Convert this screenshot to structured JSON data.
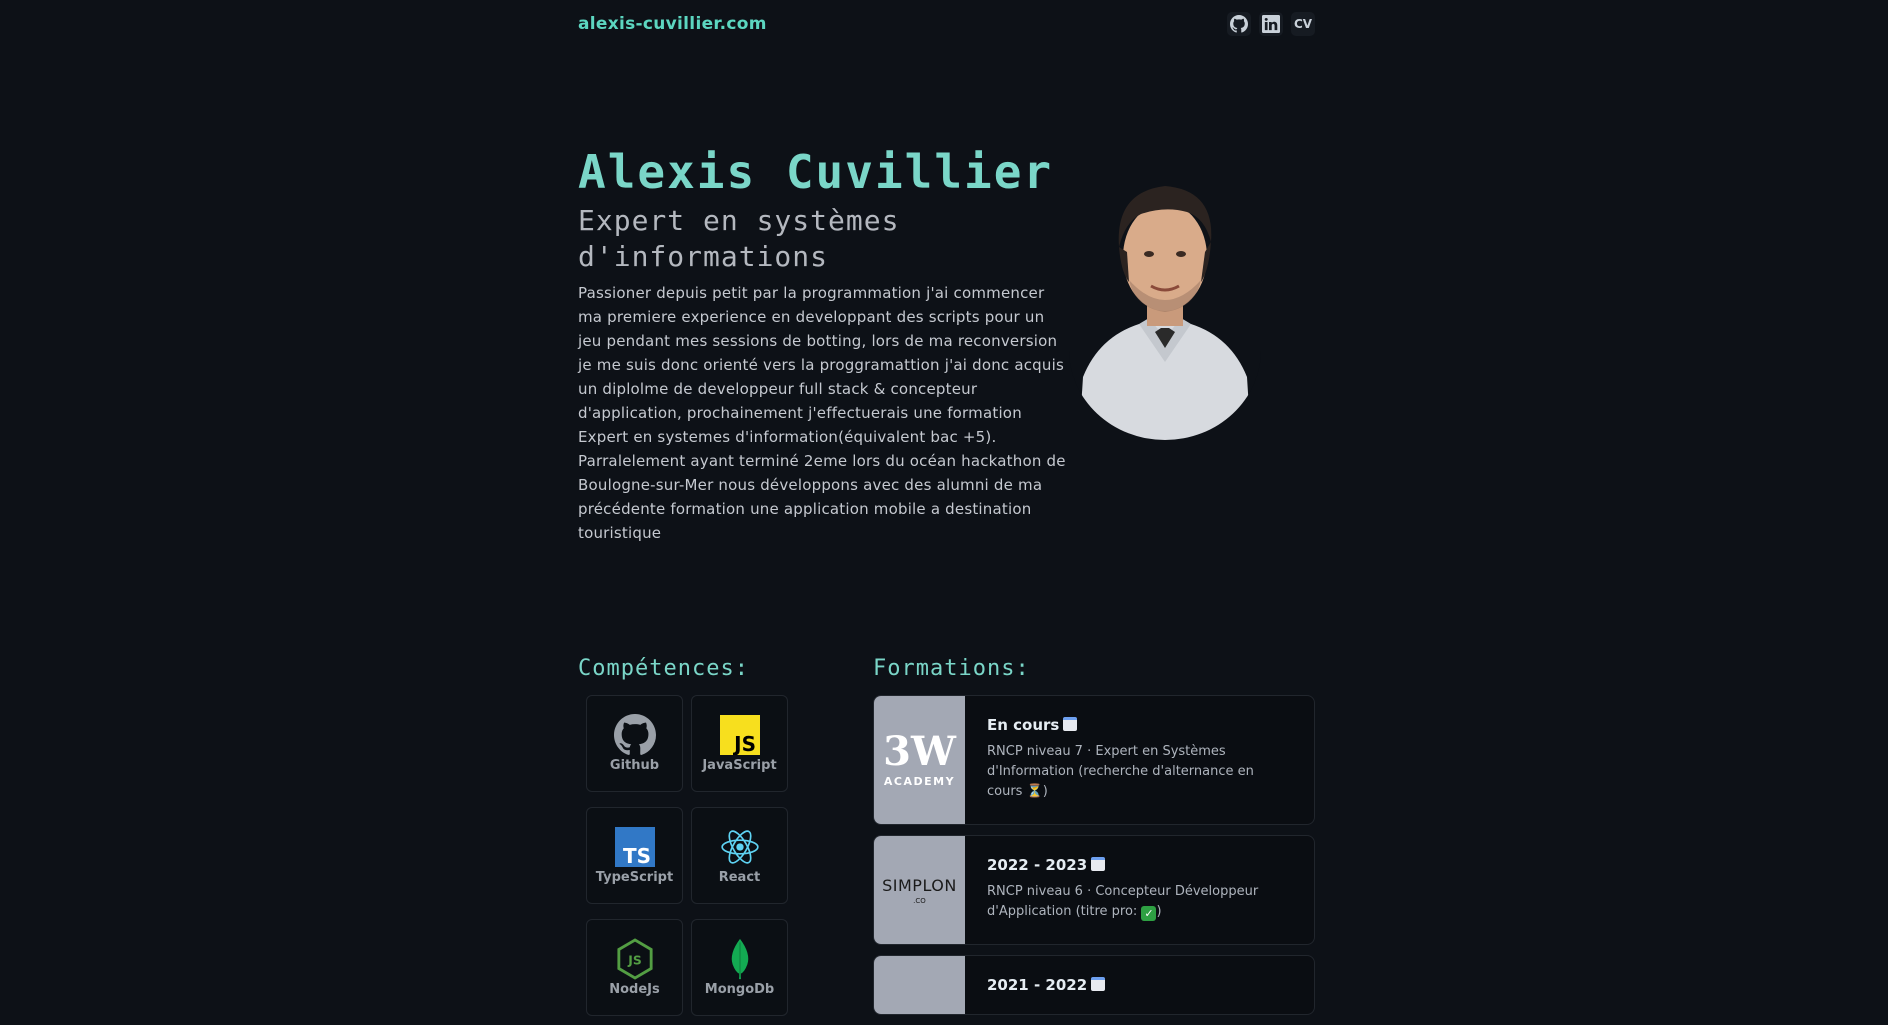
{
  "header": {
    "brand": "alexis-cuvillier.com",
    "github_icon": "github-icon",
    "linkedin_icon": "linkedin-icon",
    "cv_label": "CV"
  },
  "hero": {
    "name": "Alexis Cuvillier",
    "role": "Expert en systèmes d'informations",
    "bio_1": "Passioner depuis petit par la programmation j'ai commencer ma premiere experience en developpant des scripts pour un jeu pendant mes sessions de botting, lors de ma reconversion je me suis donc orienté vers la proggramattion j'ai donc acquis un diplolme de developpeur full stack & concepteur d'application, prochainement j'effectuerais une formation Expert en systemes d'information(équivalent bac +5).",
    "bio_2": "Parralelement ayant terminé 2eme lors du océan hackathon de Boulogne-sur-Mer nous développons avec des alumni de ma précédente formation une application mobile a destination touristique"
  },
  "skills": {
    "title": "Compétences:",
    "items": [
      {
        "label": "Github",
        "icon": "github-icon"
      },
      {
        "label": "JavaScript",
        "icon": "javascript-icon"
      },
      {
        "label": "TypeScript",
        "icon": "typescript-icon"
      },
      {
        "label": "React",
        "icon": "react-icon"
      },
      {
        "label": "NodeJs",
        "icon": "nodejs-icon"
      },
      {
        "label": "MongoDb",
        "icon": "mongodb-icon"
      }
    ]
  },
  "formations": {
    "title": "Formations:",
    "items": [
      {
        "date": "En cours",
        "desc": "RNCP niveau 7 · Expert en Systèmes d'Information (recherche d'alternance en cours",
        "desc_end": ")",
        "logo_text": "3W",
        "logo_sub": "ACADEMY"
      },
      {
        "date": "2022 - 2023",
        "desc": "RNCP niveau 6 · Concepteur Développeur d'Application (titre pro:",
        "desc_end": ")",
        "logo_text": "SIMPLON",
        "logo_sub": ".CO"
      },
      {
        "date": "2021 - 2022",
        "desc": ""
      }
    ]
  },
  "colors": {
    "accent": "#7ad6c8",
    "background": "#0d1117"
  }
}
